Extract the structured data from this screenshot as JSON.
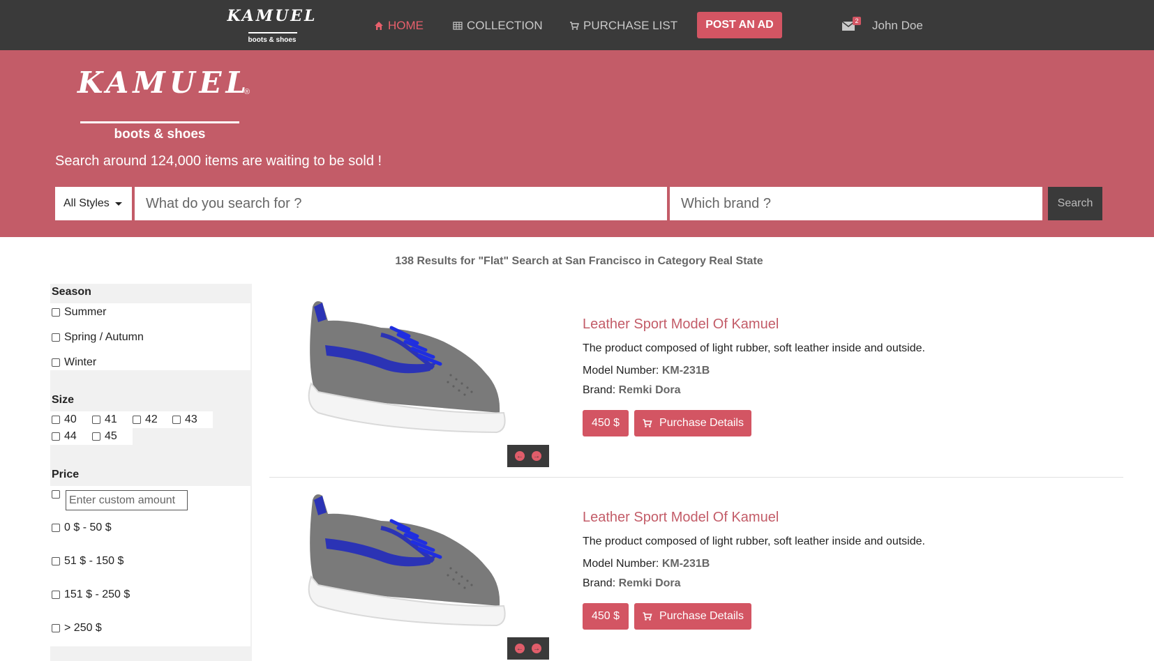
{
  "brand": {
    "name": "KAMUEL",
    "tagline": "boots & shoes",
    "reg": "®"
  },
  "nav": {
    "home": "HOME",
    "collection": "COLLECTION",
    "purchase_list": "PURCHASE LIST",
    "post_ad": "POST AN AD",
    "mail_count": "2",
    "user": "John Doe"
  },
  "hero": {
    "tagline": "Search around 124,000 items are waiting to be sold !",
    "style_select": "All Styles",
    "search_placeholder": "What do you search for ?",
    "brand_placeholder": "Which brand ?",
    "search_button": "Search"
  },
  "results_summary": "138 Results for \"Flat\" Search at San Francisco in Category Real State",
  "filters": {
    "season": {
      "title": "Season",
      "options": [
        "Summer",
        "Spring / Autumn",
        "Winter"
      ]
    },
    "size": {
      "title": "Size",
      "options": [
        "40",
        "41",
        "42",
        "43",
        "44",
        "45"
      ]
    },
    "price": {
      "title": "Price",
      "custom_placeholder": "Enter custom amount",
      "options": [
        "0 $ - 50 $",
        "51 $ - 150 $",
        "151 $ - 250 $",
        "> 250 $"
      ]
    }
  },
  "products": [
    {
      "title": "Leather Sport Model Of Kamuel",
      "description": "The product composed of light rubber, soft leather inside and outside.",
      "model_label": "Model Number:",
      "model": "KM-231B",
      "brand_label": "Brand:",
      "brand": "Remki Dora",
      "price": "450 $",
      "details": "Purchase Details"
    },
    {
      "title": "Leather Sport Model Of Kamuel",
      "description": "The product composed of light rubber, soft leather inside and outside.",
      "model_label": "Model Number:",
      "model": "KM-231B",
      "brand_label": "Brand:",
      "brand": "Remki Dora",
      "price": "450 $",
      "details": "Purchase Details"
    }
  ],
  "colors": {
    "accent": "#c35c68",
    "button": "#d35563",
    "nav_bg": "#3a3a3a",
    "shoe_upper": "#7a7a7a",
    "shoe_stripe": "#2b33b5",
    "shoe_sole": "#f4f4f4"
  }
}
